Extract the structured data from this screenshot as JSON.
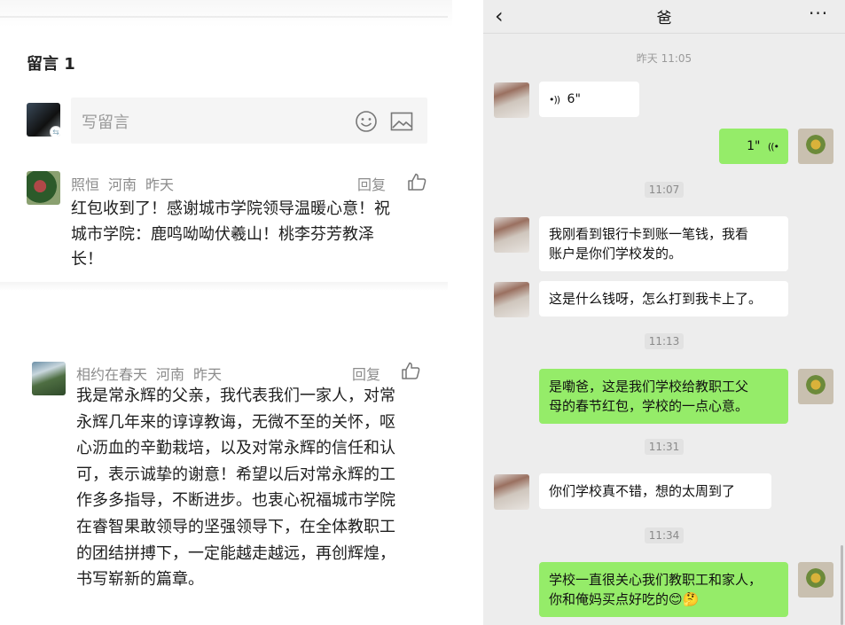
{
  "comments_section": {
    "header": "留言 1",
    "input_placeholder": "写留言",
    "comments": [
      {
        "name": "照恒",
        "location": "河南",
        "time": "昨天",
        "reply": "回复",
        "lines": [
          "红包收到了！感谢城市学院领导温暖心意！祝",
          "城市学院：鹿鸣呦呦伏羲山！桃李芬芳教泽",
          "长！"
        ]
      },
      {
        "name": "相约在春天",
        "location": "河南",
        "time": "昨天",
        "reply": "回复",
        "lines": [
          "我是常永辉的父亲，我代表我们一家人，对常",
          "永辉几年来的谆谆教诲，无微不至的关怀，呕",
          "心沥血的辛勤栽培，以及对常永辉的信任和认",
          "可，表示诚挚的谢意！希望以后对常永辉的工",
          "作多多指导，不断进步。也衷心祝福城市学院",
          "在睿智果敢领导的坚强领导下，在全体教职工",
          "的团结拼搏下，一定能越走越远，再创辉煌，",
          "书写崭新的篇章。"
        ]
      }
    ]
  },
  "chat": {
    "back_label": "‹",
    "title": "爸",
    "more_label": "···",
    "timestamps": [
      "昨天 11:05",
      "11:07",
      "11:13",
      "11:31",
      "11:34"
    ],
    "voice_in": {
      "icon": "•))",
      "duration": "6\""
    },
    "voice_out": {
      "icon": "((•",
      "duration": "1\""
    },
    "messages": [
      {
        "from": "dad",
        "lines": [
          "我刚看到银行卡到账一笔钱，我看",
          "账户是你们学校发的。"
        ]
      },
      {
        "from": "dad",
        "lines": [
          "这是什么钱呀，怎么打到我卡上了。"
        ]
      },
      {
        "from": "self",
        "lines": [
          "是嘞爸，这是我们学校给教职工父",
          "母的春节红包，学校的一点心意。"
        ]
      },
      {
        "from": "dad",
        "lines": [
          "你们学校真不错，想的太周到了"
        ]
      },
      {
        "from": "self",
        "lines": [
          "学校一直很关心我们教职工和家人，",
          "你和俺妈买点好吃的😊🤔"
        ]
      }
    ]
  },
  "colors": {
    "green_bubble": "#95ec69",
    "chat_bg": "#ededed",
    "meta_gray": "#8c8c8c"
  }
}
